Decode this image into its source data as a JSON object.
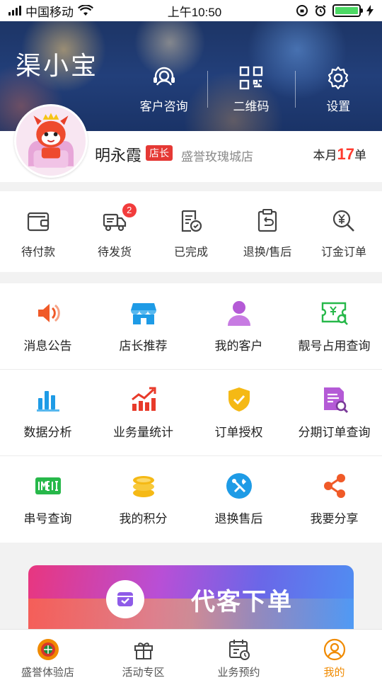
{
  "statusbar": {
    "carrier": "中国移动",
    "time": "上午10:50"
  },
  "header": {
    "app_title": "渠小宝",
    "actions": [
      {
        "label": "客户咨询",
        "icon": "headset-icon"
      },
      {
        "label": "二维码",
        "icon": "qrcode-icon"
      },
      {
        "label": "设置",
        "icon": "gear-icon"
      }
    ]
  },
  "profile": {
    "name": "明永霞",
    "role": "店长",
    "store": "盛誉玫瑰城店",
    "monthly_prefix": "本月",
    "monthly_count": "17",
    "monthly_suffix": "单"
  },
  "orders": [
    {
      "label": "待付款",
      "icon": "wallet-icon"
    },
    {
      "label": "待发货",
      "icon": "truck-icon",
      "badge": "2"
    },
    {
      "label": "已完成",
      "icon": "done-doc-icon"
    },
    {
      "label": "退换/售后",
      "icon": "return-icon"
    },
    {
      "label": "订金订单",
      "icon": "deposit-search-icon"
    }
  ],
  "grid": [
    {
      "label": "消息公告",
      "icon": "speaker-icon",
      "color": "#f05a28"
    },
    {
      "label": "店长推荐",
      "icon": "store-icon",
      "color": "#1e9be6"
    },
    {
      "label": "我的客户",
      "icon": "user-icon",
      "color": "#b45ad6"
    },
    {
      "label": "靓号占用查询",
      "icon": "ticket-search-icon",
      "color": "#27b84a"
    },
    {
      "label": "数据分析",
      "icon": "bar-chart-icon",
      "color": "#1e9be6"
    },
    {
      "label": "业务量统计",
      "icon": "trend-chart-icon",
      "color": "#e83a2a"
    },
    {
      "label": "订单授权",
      "icon": "shield-check-icon",
      "color": "#f5b915"
    },
    {
      "label": "分期订单查询",
      "icon": "doc-search-icon",
      "color": "#b45ad6"
    },
    {
      "label": "串号查询",
      "icon": "imei-icon",
      "color": "#27b84a"
    },
    {
      "label": "我的积分",
      "icon": "coins-icon",
      "color": "#f5b915"
    },
    {
      "label": "退换售后",
      "icon": "tools-icon",
      "color": "#1e9be6"
    },
    {
      "label": "我要分享",
      "icon": "share-icon",
      "color": "#f05a28"
    }
  ],
  "banner": {
    "label": "代客下单"
  },
  "tabs": [
    {
      "label": "盛誉体验店",
      "icon": "store-logo-icon"
    },
    {
      "label": "活动专区",
      "icon": "gift-icon"
    },
    {
      "label": "业务预约",
      "icon": "calendar-icon"
    },
    {
      "label": "我的",
      "icon": "user-circle-icon",
      "active": true
    }
  ],
  "colors": {
    "accent": "#f08a00",
    "badge": "#f23c3c",
    "role_tag": "#e53935",
    "count": "#ff3b2f"
  }
}
